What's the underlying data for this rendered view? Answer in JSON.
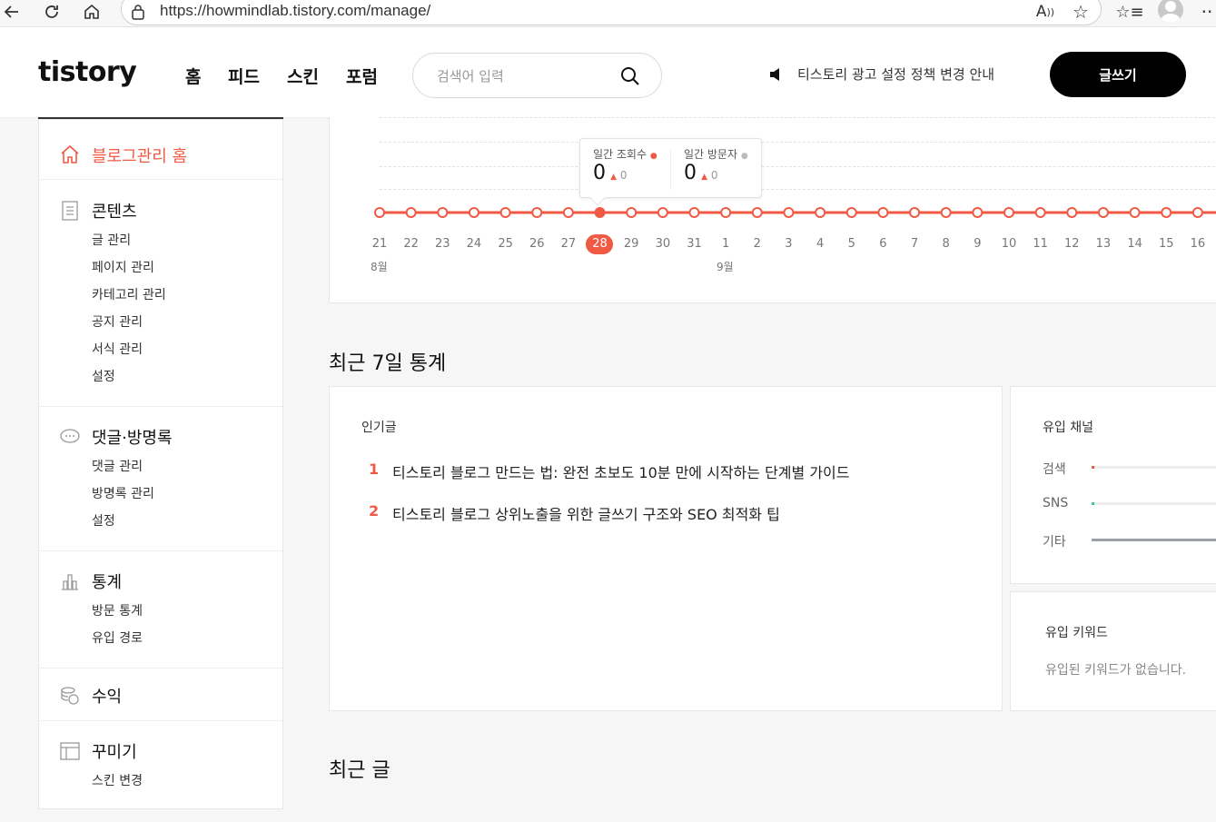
{
  "browser": {
    "url": "https://howmindlab.tistory.com/manage/",
    "icons": [
      "back-icon",
      "refresh-icon",
      "home-icon",
      "lock-icon",
      "read-aloud-icon",
      "favorite-icon",
      "favorites-list-icon",
      "profile-avatar",
      "more-icon"
    ]
  },
  "header": {
    "logo": "tistory",
    "nav": [
      "홈",
      "피드",
      "스킨",
      "포럼"
    ],
    "search_placeholder": "검색어 입력",
    "notice": "티스토리 광고 설정 정책 변경 안내",
    "write_label": "글쓰기"
  },
  "sidebar": {
    "home": "블로그관리 홈",
    "groups": [
      {
        "title": "콘텐츠",
        "icon": "document-icon",
        "items": [
          "글 관리",
          "페이지 관리",
          "카테고리 관리",
          "공지 관리",
          "서식 관리",
          "설정"
        ]
      },
      {
        "title": "댓글·방명록",
        "icon": "comment-icon",
        "items": [
          "댓글 관리",
          "방명록 관리",
          "설정"
        ]
      },
      {
        "title": "통계",
        "icon": "bar-chart-icon",
        "items": [
          "방문 통계",
          "유입 경로"
        ]
      },
      {
        "title": "수익",
        "icon": "coins-icon",
        "items": []
      },
      {
        "title": "꾸미기",
        "icon": "layout-icon",
        "items": [
          "스킨 변경"
        ]
      }
    ]
  },
  "chart_data": {
    "type": "line",
    "x": [
      "21",
      "22",
      "23",
      "24",
      "25",
      "26",
      "27",
      "28",
      "29",
      "30",
      "31",
      "1",
      "2",
      "3",
      "4",
      "5",
      "6",
      "7",
      "8",
      "9",
      "10",
      "11",
      "12",
      "13",
      "14",
      "15",
      "16"
    ],
    "month_labels": [
      {
        "at": "21",
        "label": "8월"
      },
      {
        "at": "1",
        "label": "9월"
      }
    ],
    "series": [
      {
        "name": "일간 조회수",
        "values": [
          0,
          0,
          0,
          0,
          0,
          0,
          0,
          0,
          0,
          0,
          0,
          0,
          0,
          0,
          0,
          0,
          0,
          0,
          0,
          0,
          0,
          0,
          0,
          0,
          0,
          0,
          0
        ]
      }
    ],
    "selected": "28",
    "color": "#f05a44",
    "tooltip": {
      "views_label": "일간 조회수",
      "views_value": "0",
      "views_delta": "0",
      "visitors_label": "일간 방문자",
      "visitors_value": "0",
      "visitors_delta": "0"
    }
  },
  "stats7": {
    "heading": "최근 7일 통계",
    "popular": {
      "title": "인기글",
      "items": [
        {
          "rank": "1",
          "title": "티스토리 블로그 만드는 법: 완전 초보도 10분 만에 시작하는 단계별 가이드"
        },
        {
          "rank": "2",
          "title": "티스토리 블로그 상위노출을 위한 글쓰기 구조와 SEO 최적화 팁"
        }
      ]
    },
    "channels": {
      "title": "유입 채널",
      "items": [
        {
          "label": "검색",
          "fraction": 0.0,
          "color": "#f05a44"
        },
        {
          "label": "SNS",
          "fraction": 0.0,
          "color": "#3cc3a0"
        },
        {
          "label": "기타",
          "fraction": 1.0,
          "color": "#9aa0a6"
        }
      ]
    },
    "keywords": {
      "title": "유입 키워드",
      "empty": "유입된 키워드가 없습니다."
    }
  },
  "recent": {
    "heading": "최근 글"
  }
}
